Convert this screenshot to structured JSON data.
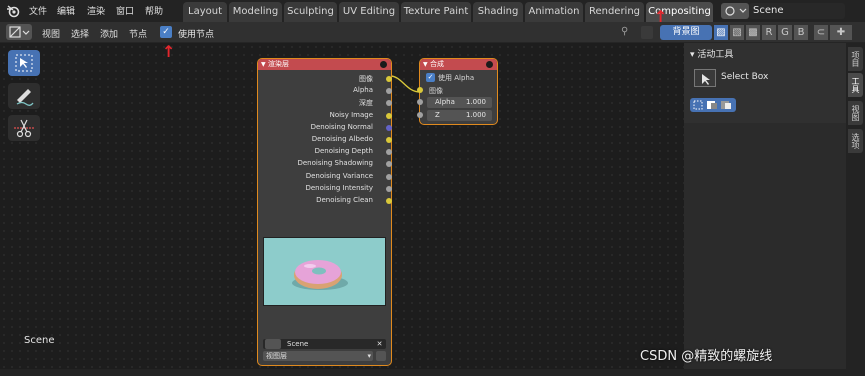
{
  "menubar": {
    "items": [
      "文件",
      "编辑",
      "渲染",
      "窗口",
      "帮助"
    ]
  },
  "workspaces": {
    "tabs": [
      "Layout",
      "Modeling",
      "Sculpting",
      "UV Editing",
      "Texture Paint",
      "Shading",
      "Animation",
      "Rendering",
      "Compositing"
    ],
    "active": "Compositing"
  },
  "scene_selector": {
    "value": "Scene"
  },
  "node_header": {
    "menus": [
      "视图",
      "选择",
      "添加",
      "节点"
    ],
    "use_nodes_checked": true,
    "use_nodes_label": "使用节点",
    "backdrop_label": "背景图",
    "channels": [
      "R",
      "G",
      "B"
    ]
  },
  "render_layers_node": {
    "title": "渲染层",
    "outputs": [
      "图像",
      "Alpha",
      "深度",
      "Noisy Image",
      "Denoising Normal",
      "Denoising Albedo",
      "Denoising Depth",
      "Denoising Shadowing",
      "Denoising Variance",
      "Denoising Intensity",
      "Denoising Clean"
    ],
    "scene": "Scene",
    "layer": "视图层"
  },
  "composite_node": {
    "title": "合成",
    "use_alpha_label": "使用 Alpha",
    "use_alpha_checked": true,
    "input_label": "图像",
    "fields": [
      {
        "label": "Alpha",
        "value": "1.000"
      },
      {
        "label": "Z",
        "value": "1.000"
      }
    ]
  },
  "sidebar": {
    "panel_title": "活动工具",
    "tool_name": "Select Box",
    "tabs": [
      "项目",
      "工具",
      "视图",
      "选项"
    ],
    "active_tab": "工具"
  },
  "canvas": {
    "scene_label": "Scene"
  },
  "watermark": "CSDN @精致的螺旋线",
  "colors": {
    "accent": "#4772b3",
    "node_header": "#c34b4f",
    "selected_outline": "#e08a1e",
    "annotation": "#e3262d"
  }
}
